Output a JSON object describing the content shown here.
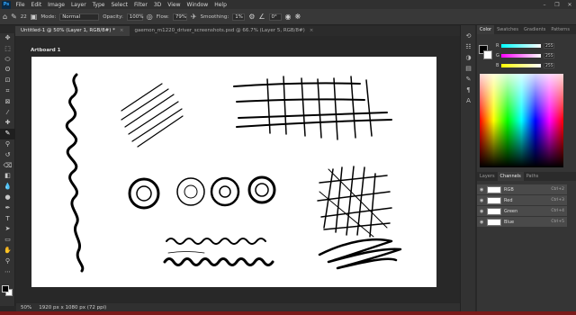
{
  "app": {
    "logo": "Ps"
  },
  "menu": [
    "File",
    "Edit",
    "Image",
    "Layer",
    "Type",
    "Select",
    "Filter",
    "3D",
    "View",
    "Window",
    "Help"
  ],
  "window_controls": [
    "–",
    "❐",
    "✕"
  ],
  "options": {
    "brush_size": "22",
    "mode_label": "Mode:",
    "mode_value": "Normal",
    "opacity_label": "Opacity:",
    "opacity_value": "100%",
    "flow_label": "Flow:",
    "flow_value": "79%",
    "smoothing_label": "Smoothing:",
    "smoothing_value": "1%",
    "angle_value": "0°"
  },
  "tabs": [
    {
      "label": "Untitled-1 @ 50% (Layer 1, RGB/8#) *",
      "active": true
    },
    {
      "label": "gaemon_m1220_driver_screenshots.psd @ 66.7% (Layer 5, RGB/8#)",
      "active": false
    }
  ],
  "artboard_label": "Artboard 1",
  "status": {
    "zoom": "50%",
    "doc_size": "1920 px x 1080 px (72 ppi)"
  },
  "color_panel": {
    "tabs": [
      "Color",
      "Swatches",
      "Gradients",
      "Patterns"
    ],
    "sliders": [
      {
        "label": "R",
        "value": "255",
        "gradient": [
          "#00ffff",
          "#ffffff"
        ]
      },
      {
        "label": "G",
        "value": "255",
        "gradient": [
          "#ff00ff",
          "#ffffff"
        ]
      },
      {
        "label": "B",
        "value": "255",
        "gradient": [
          "#ffff00",
          "#ffffff"
        ]
      }
    ]
  },
  "channels_panel": {
    "tabs": [
      "Layers",
      "Channels",
      "Paths"
    ],
    "rows": [
      {
        "name": "RGB",
        "shortcut": "Ctrl+2"
      },
      {
        "name": "Red",
        "shortcut": "Ctrl+3"
      },
      {
        "name": "Green",
        "shortcut": "Ctrl+4"
      },
      {
        "name": "Blue",
        "shortcut": "Ctrl+5"
      }
    ]
  },
  "colors": {
    "accent": "#31a8ff",
    "red_strip": "#7a1a1a"
  }
}
